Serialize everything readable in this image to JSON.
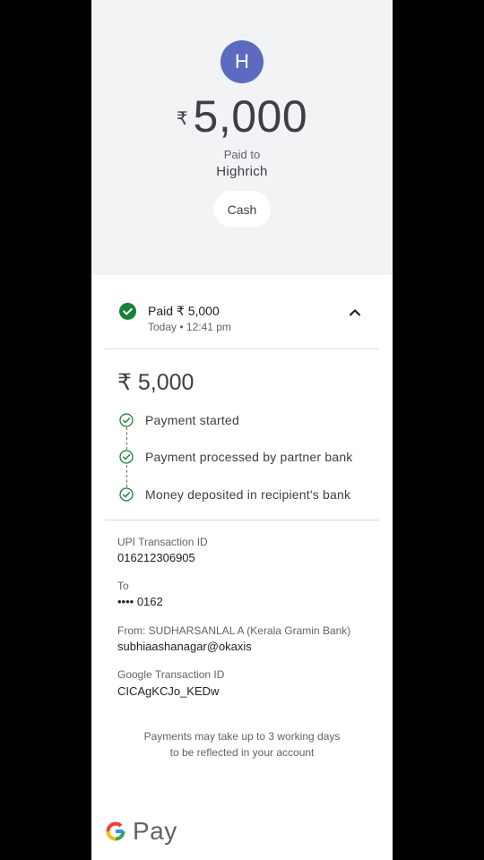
{
  "hero": {
    "avatar_initial": "H",
    "currency_symbol": "₹",
    "amount": "5,000",
    "paid_to_label": "Paid to",
    "payee_name": "Highrich",
    "method_chip": "Cash"
  },
  "status": {
    "title": "Paid ₹ 5,000",
    "time": "Today • 12:41 pm",
    "expanded": true
  },
  "details": {
    "amount": "₹ 5,000",
    "steps": [
      {
        "label": "Payment started"
      },
      {
        "label": "Payment processed by partner bank"
      },
      {
        "label": "Money deposited in recipient's bank"
      }
    ]
  },
  "fields": {
    "upi_label": "UPI Transaction ID",
    "upi_value": "016212306905",
    "to_label": "To",
    "to_value": "•••• 0162",
    "from_label": "From: SUDHARSANLAL A (Kerala Gramin Bank)",
    "from_value": "subhiaashanagar@okaxis",
    "google_id_label": "Google Transaction ID",
    "google_id_value": "CICAgKCJo_KEDw"
  },
  "notice": {
    "line1": "Payments may take up to 3 working days",
    "line2": "to be reflected in your account"
  },
  "footer": {
    "brand_text": "Pay"
  },
  "colors": {
    "avatar": "#5c6bc0",
    "success": "#188038",
    "hero_bg": "#f1f3f4"
  }
}
